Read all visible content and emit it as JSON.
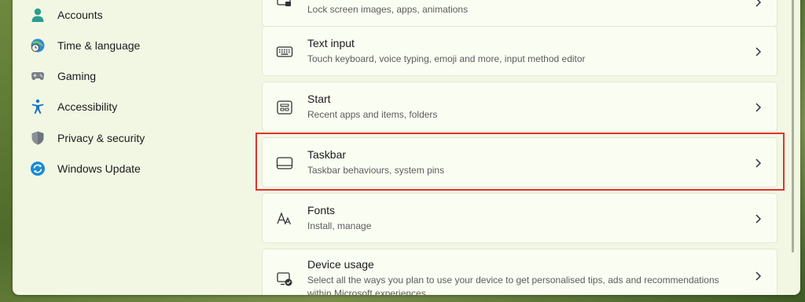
{
  "nav": {
    "items": [
      {
        "label": "Accounts",
        "icon": "accounts-icon"
      },
      {
        "label": "Time & language",
        "icon": "time-language-icon"
      },
      {
        "label": "Gaming",
        "icon": "gaming-icon"
      },
      {
        "label": "Accessibility",
        "icon": "accessibility-icon"
      },
      {
        "label": "Privacy & security",
        "icon": "shield-icon"
      },
      {
        "label": "Windows Update",
        "icon": "windows-update-icon"
      }
    ]
  },
  "cards": [
    {
      "title": "",
      "desc": "Lock screen images, apps, animations",
      "icon": "lock-screen-icon"
    },
    {
      "title": "Text input",
      "desc": "Touch keyboard, voice typing, emoji and more, input method editor",
      "icon": "keyboard-icon"
    },
    {
      "title": "Start",
      "desc": "Recent apps and items, folders",
      "icon": "start-icon"
    },
    {
      "title": "Taskbar",
      "desc": "Taskbar behaviours, system pins",
      "icon": "taskbar-icon"
    },
    {
      "title": "Fonts",
      "desc": "Install, manage",
      "icon": "fonts-icon"
    },
    {
      "title": "Device usage",
      "desc": "Select all the ways you plan to use your device to get personalised tips, ads and recommendations",
      "desc2": "within Microsoft experiences",
      "icon": "device-usage-icon"
    }
  ],
  "colors": {
    "accent": "#0067c0",
    "highlight": "#e0332e"
  }
}
